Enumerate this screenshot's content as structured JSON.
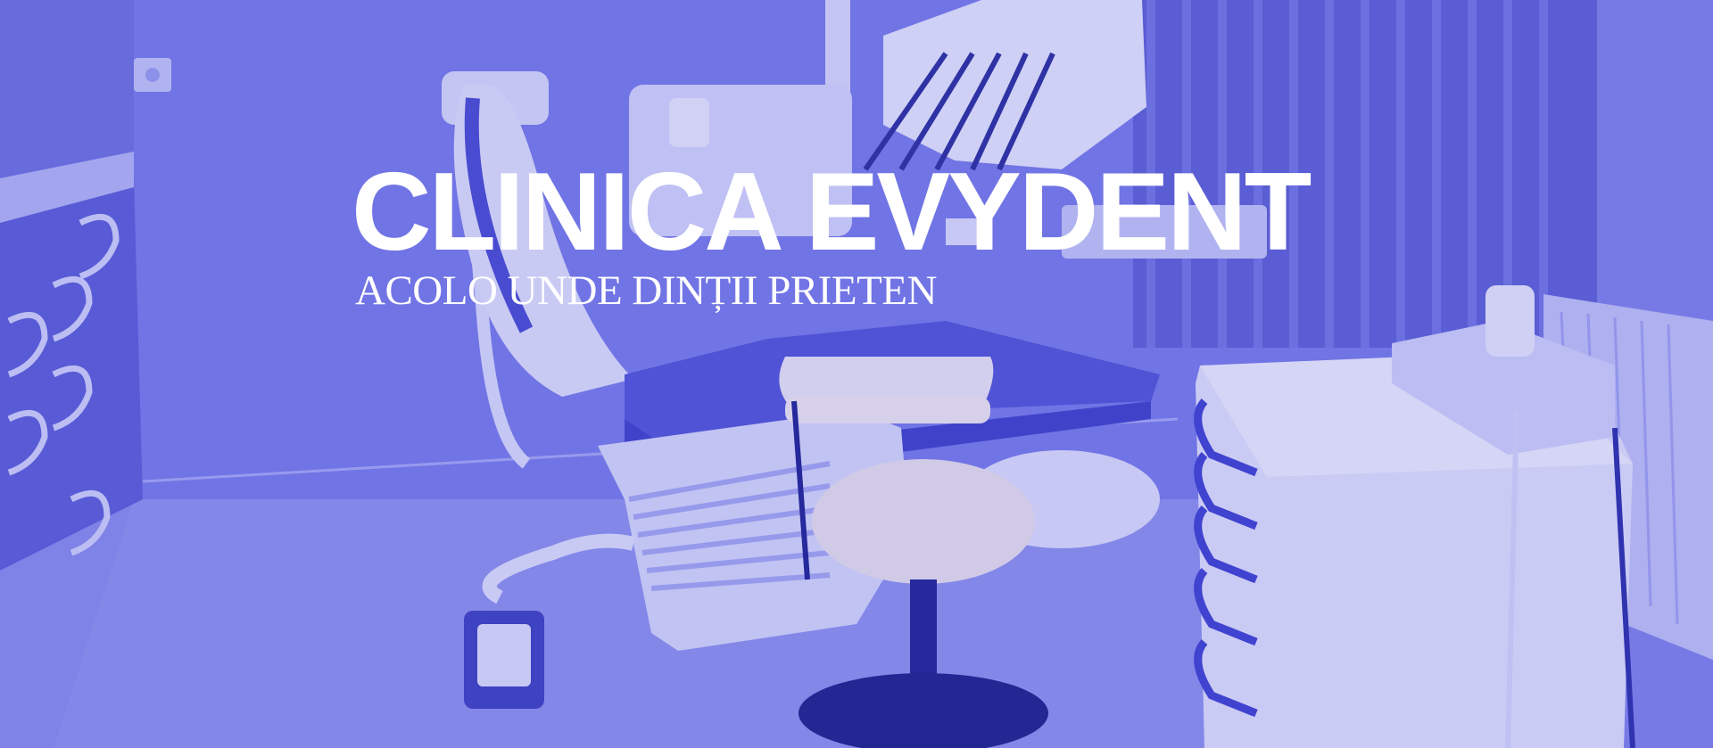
{
  "hero": {
    "title": "CLINICA EVYDENT",
    "subtitle": "ACOLO UNDE DINȚII PRIETEN",
    "background_image": "dental-office-photo",
    "overlay_color": "#5b5fe0"
  }
}
